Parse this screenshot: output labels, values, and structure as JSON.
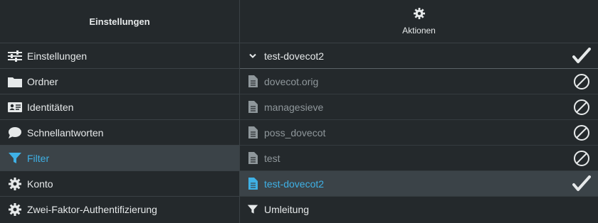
{
  "left_header": "Einstellungen",
  "nav": [
    {
      "label": "Einstellungen",
      "icon": "sliders-icon"
    },
    {
      "label": "Ordner",
      "icon": "folder-icon"
    },
    {
      "label": "Identitäten",
      "icon": "id-card-icon"
    },
    {
      "label": "Schnellantworten",
      "icon": "speech-bubble-icon"
    },
    {
      "label": "Filter",
      "icon": "filter-icon",
      "active": true
    },
    {
      "label": "Konto",
      "icon": "gear-icon"
    },
    {
      "label": "Zwei-Faktor-Authentifizierung",
      "icon": "gear-icon"
    }
  ],
  "actions_label": "Aktionen",
  "filterset": {
    "label": "test-dovecot2",
    "status": "active"
  },
  "scripts": [
    {
      "label": "dovecot.orig",
      "status": "inactive"
    },
    {
      "label": "managesieve",
      "status": "inactive"
    },
    {
      "label": "poss_dovecot",
      "status": "inactive"
    },
    {
      "label": "test",
      "status": "inactive"
    },
    {
      "label": "test-dovecot2",
      "status": "active",
      "selected": true
    }
  ],
  "redirect_label": "Umleitung",
  "colors": {
    "accent": "#3fb1e6",
    "background": "#24292c",
    "active_row": "#3b4348"
  }
}
